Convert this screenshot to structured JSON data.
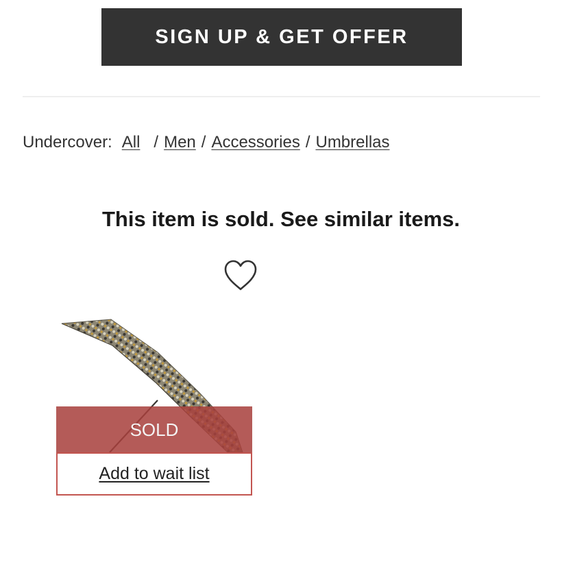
{
  "signup": {
    "label": "SIGN UP & GET OFFER"
  },
  "breadcrumb": {
    "brand": "Undercover:",
    "items": [
      {
        "label": "All"
      },
      {
        "label": "Men"
      },
      {
        "label": "Accessories"
      },
      {
        "label": "Umbrellas"
      }
    ],
    "separator": "/"
  },
  "status": {
    "message": "This item is sold. See similar items."
  },
  "icons": {
    "favorite": "heart-outline-icon"
  },
  "product": {
    "image": "patterned-umbrella-image",
    "sold_label": "SOLD",
    "waitlist_label": "Add to wait list"
  },
  "colors": {
    "signup_bg": "#333333",
    "sold_overlay": "#a8403c",
    "waitlist_border": "#c25550"
  }
}
